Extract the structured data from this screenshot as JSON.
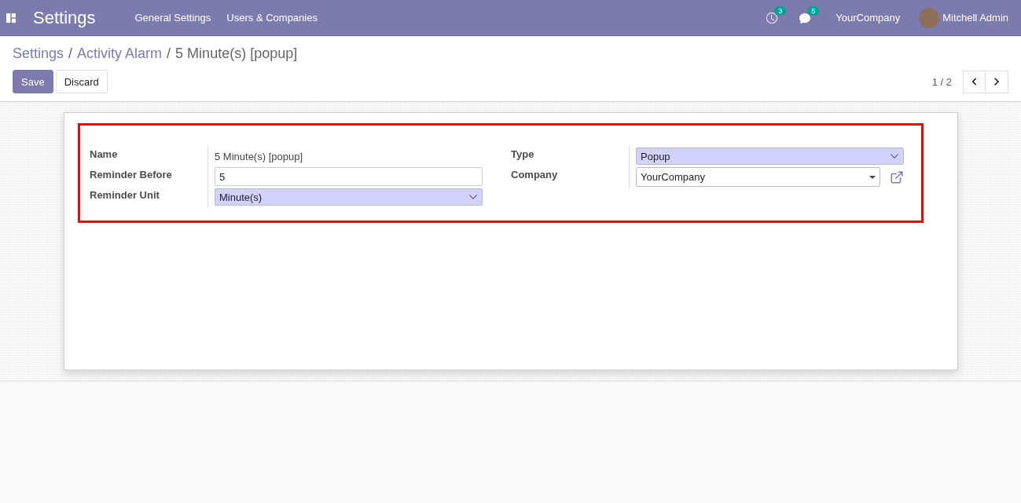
{
  "navbar": {
    "app_title": "Settings",
    "menu": [
      "General Settings",
      "Users & Companies"
    ],
    "activity_count": "3",
    "message_count": "5",
    "company": "YourCompany",
    "user": "Mitchell Admin"
  },
  "breadcrumb_separator": "/",
  "breadcrumbs": [
    {
      "label": "Settings",
      "kind": "link"
    },
    {
      "label": "Activity Alarm",
      "kind": "link"
    },
    {
      "label": "5 Minute(s) [popup]",
      "kind": "current"
    }
  ],
  "buttons": [
    {
      "label": "Save",
      "kind": "primary"
    },
    {
      "label": "Discard",
      "kind": "secondary"
    }
  ],
  "pager": {
    "text": "1 / 2"
  },
  "groups": [
    [
      {
        "label": "Name",
        "kind": "text",
        "value": "5 Minute(s) [popup]"
      },
      {
        "label": "Reminder Before",
        "kind": "input",
        "value": "5"
      },
      {
        "label": "Reminder Unit",
        "kind": "select",
        "value": "Minute(s)"
      }
    ],
    [
      {
        "label": "Type",
        "kind": "select",
        "value": "Popup"
      },
      {
        "label": "Company",
        "kind": "many2one",
        "value": "YourCompany"
      }
    ]
  ]
}
